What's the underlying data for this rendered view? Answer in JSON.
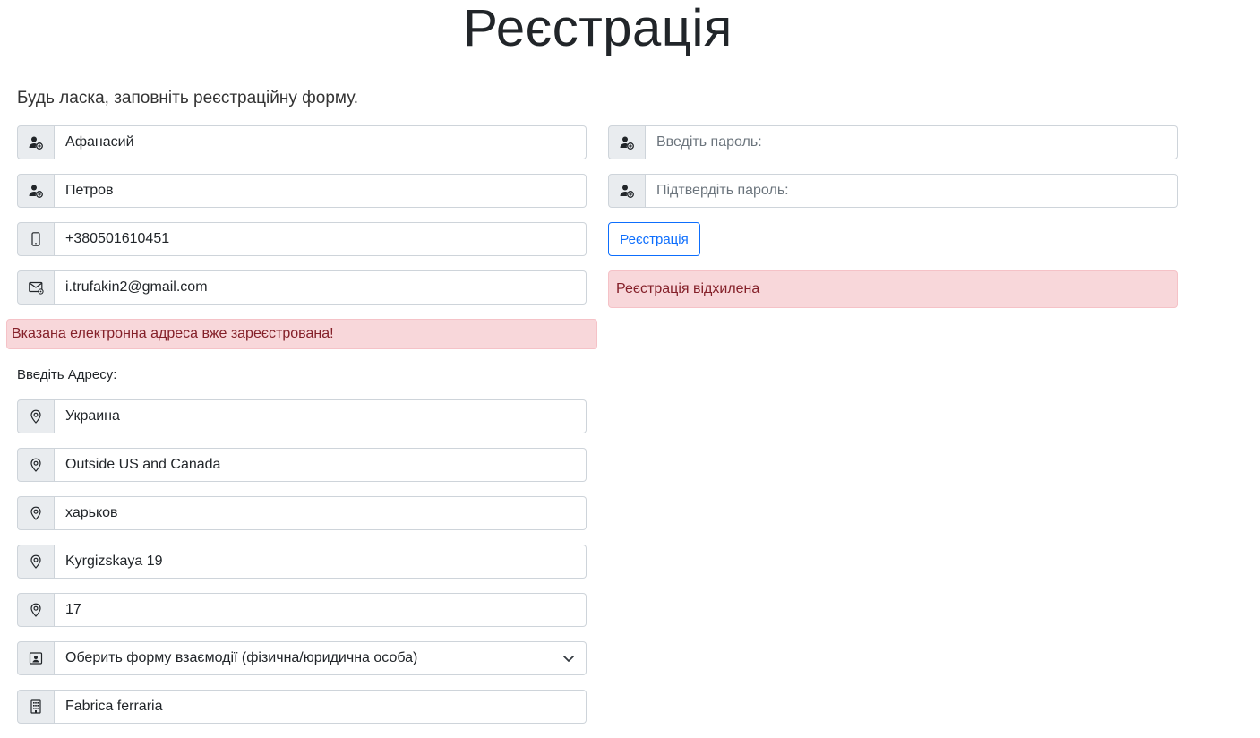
{
  "page": {
    "title": "Реєстрація",
    "subtitle": "Будь ласка, заповніть реєстраційну форму."
  },
  "form": {
    "first_name": {
      "value": "Афанасий",
      "icon": "user-plus-icon"
    },
    "last_name": {
      "value": "Петров",
      "icon": "user-plus-icon"
    },
    "phone": {
      "value": "+380501610451",
      "icon": "phone-icon"
    },
    "email": {
      "value": "i.trufakin2@gmail.com",
      "icon": "email-icon"
    },
    "email_error": "Вказана електронна адреса вже зареєстрована!",
    "password": {
      "placeholder": "Введіть пароль:",
      "icon": "user-plus-icon"
    },
    "password_confirm": {
      "placeholder": "Підтвердіть пароль:",
      "icon": "user-plus-icon"
    },
    "submit_label": "Реєстрація",
    "registration_error": "Реєстрація відхилена",
    "address_label": "Введіть Адресу:",
    "address": {
      "country": "Украина",
      "region": "Outside US and Canada",
      "city": "харьков",
      "street": "Kyrgizskaya 19",
      "apartment": "17"
    },
    "interaction_form": {
      "selected": "Оберить форму взаємодії (фізична/юридична особа)",
      "icon": "person-badge-icon"
    },
    "company": {
      "value": "Fabrica ferraria",
      "icon": "building-icon"
    }
  },
  "colors": {
    "alert_bg": "#f8d7da",
    "alert_text": "#842029",
    "primary": "#0d6efd"
  }
}
